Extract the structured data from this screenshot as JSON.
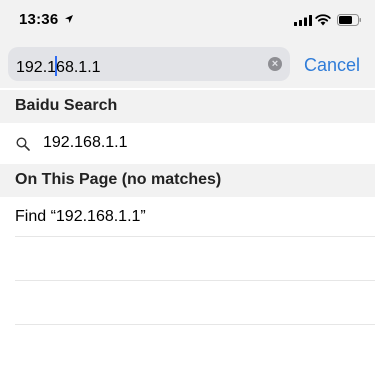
{
  "status_bar": {
    "time": "13:36",
    "icons": [
      "location-arrow-icon",
      "signal-bars-icon",
      "wifi-icon",
      "battery-icon"
    ]
  },
  "search": {
    "text_before_cursor": "192.1",
    "text_after_cursor": "68.1.1",
    "cancel_label": "Cancel",
    "accent_color": "#2f7cd8"
  },
  "sections": [
    {
      "title": "Baidu Search",
      "items": [
        {
          "icon": "magnifier-icon",
          "label": "192.168.1.1"
        }
      ]
    },
    {
      "title": "On This Page (no matches)",
      "items": [
        {
          "label": "Find “192.168.1.1”"
        }
      ]
    }
  ]
}
